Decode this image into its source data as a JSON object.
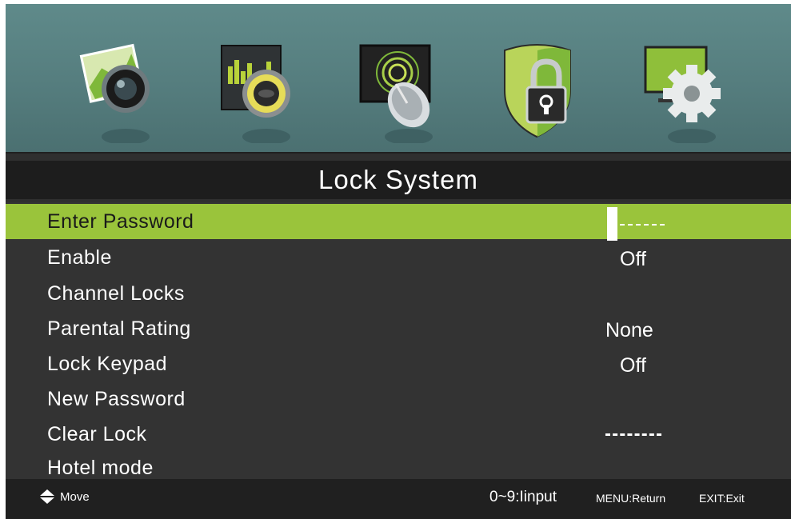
{
  "header": {
    "icons": [
      {
        "name": "picture-icon"
      },
      {
        "name": "sound-icon"
      },
      {
        "name": "channel-icon"
      },
      {
        "name": "lock-icon"
      },
      {
        "name": "setup-icon"
      }
    ]
  },
  "title": "Lock System",
  "menu": {
    "items": [
      {
        "label": "Enter Password",
        "value": ""
      },
      {
        "label": "Enable",
        "value": "Off"
      },
      {
        "label": "Channel Locks",
        "value": ""
      },
      {
        "label": "Parental Rating",
        "value": "None"
      },
      {
        "label": "Lock Keypad",
        "value": "Off"
      },
      {
        "label": "New Password",
        "value": ""
      },
      {
        "label": "Clear Lock",
        "value": ""
      },
      {
        "label": "Hotel mode",
        "value": ""
      }
    ]
  },
  "footer": {
    "move": "Move",
    "input": "0~9:Iinput",
    "menu": "MENU:Return",
    "exit": "EXIT:Exit"
  },
  "colors": {
    "highlight": "#9ac43b",
    "band": "#557d7e",
    "background": "#333333"
  }
}
